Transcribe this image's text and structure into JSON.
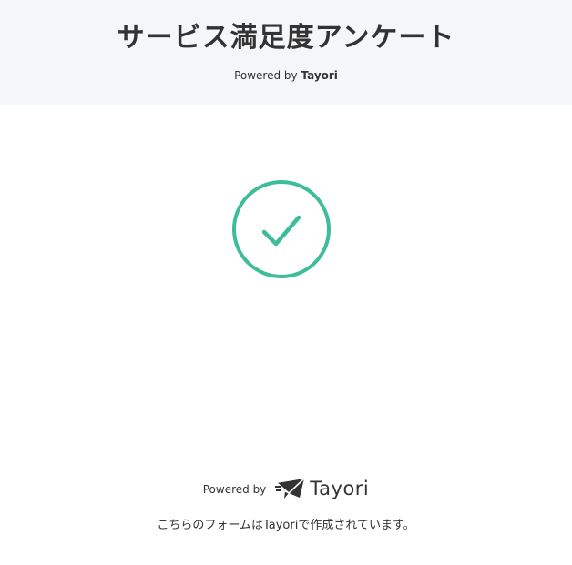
{
  "header": {
    "title": "サービス満足度アンケート",
    "powered_prefix": "Powered by ",
    "powered_brand": "Tayori"
  },
  "success": {
    "icon": "check-circle-icon",
    "accent_color": "#3dbd99"
  },
  "footer": {
    "powered_label": "Powered by",
    "logo_icon": "tayori-logo-icon",
    "logo_text": "Tayori",
    "note_prefix": "こちらのフォームは",
    "note_link": "Tayori",
    "note_suffix": "で作成されています。"
  },
  "colors": {
    "header_bg": "#f5f6f8",
    "text": "#333333",
    "accent": "#3dbd99"
  }
}
